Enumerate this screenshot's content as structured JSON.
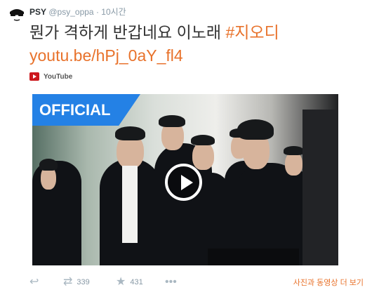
{
  "header": {
    "name": "PSY",
    "handle": "@psy_oppa",
    "separator": "·",
    "time": "10시간"
  },
  "tweet": {
    "text": "뭔가 격하게 반갑네요 이노래 ",
    "hashtag": "#지오디",
    "link": "youtu.be/hPj_0aY_fl4"
  },
  "source": {
    "label": "YouTube"
  },
  "video": {
    "badge": "OFFICIAL"
  },
  "actions": {
    "reply_icon": "reply-icon",
    "retweet_icon": "retweet-icon",
    "retweet_count": "339",
    "favorite_icon": "star-icon",
    "favorite_count": "431",
    "more_icon": "more-icon",
    "view_more": "사진과 동영상 더 보기"
  },
  "colors": {
    "accent": "#e8722b",
    "muted": "#8899a6",
    "youtube": "#cc181e",
    "official": "#2481e5"
  }
}
